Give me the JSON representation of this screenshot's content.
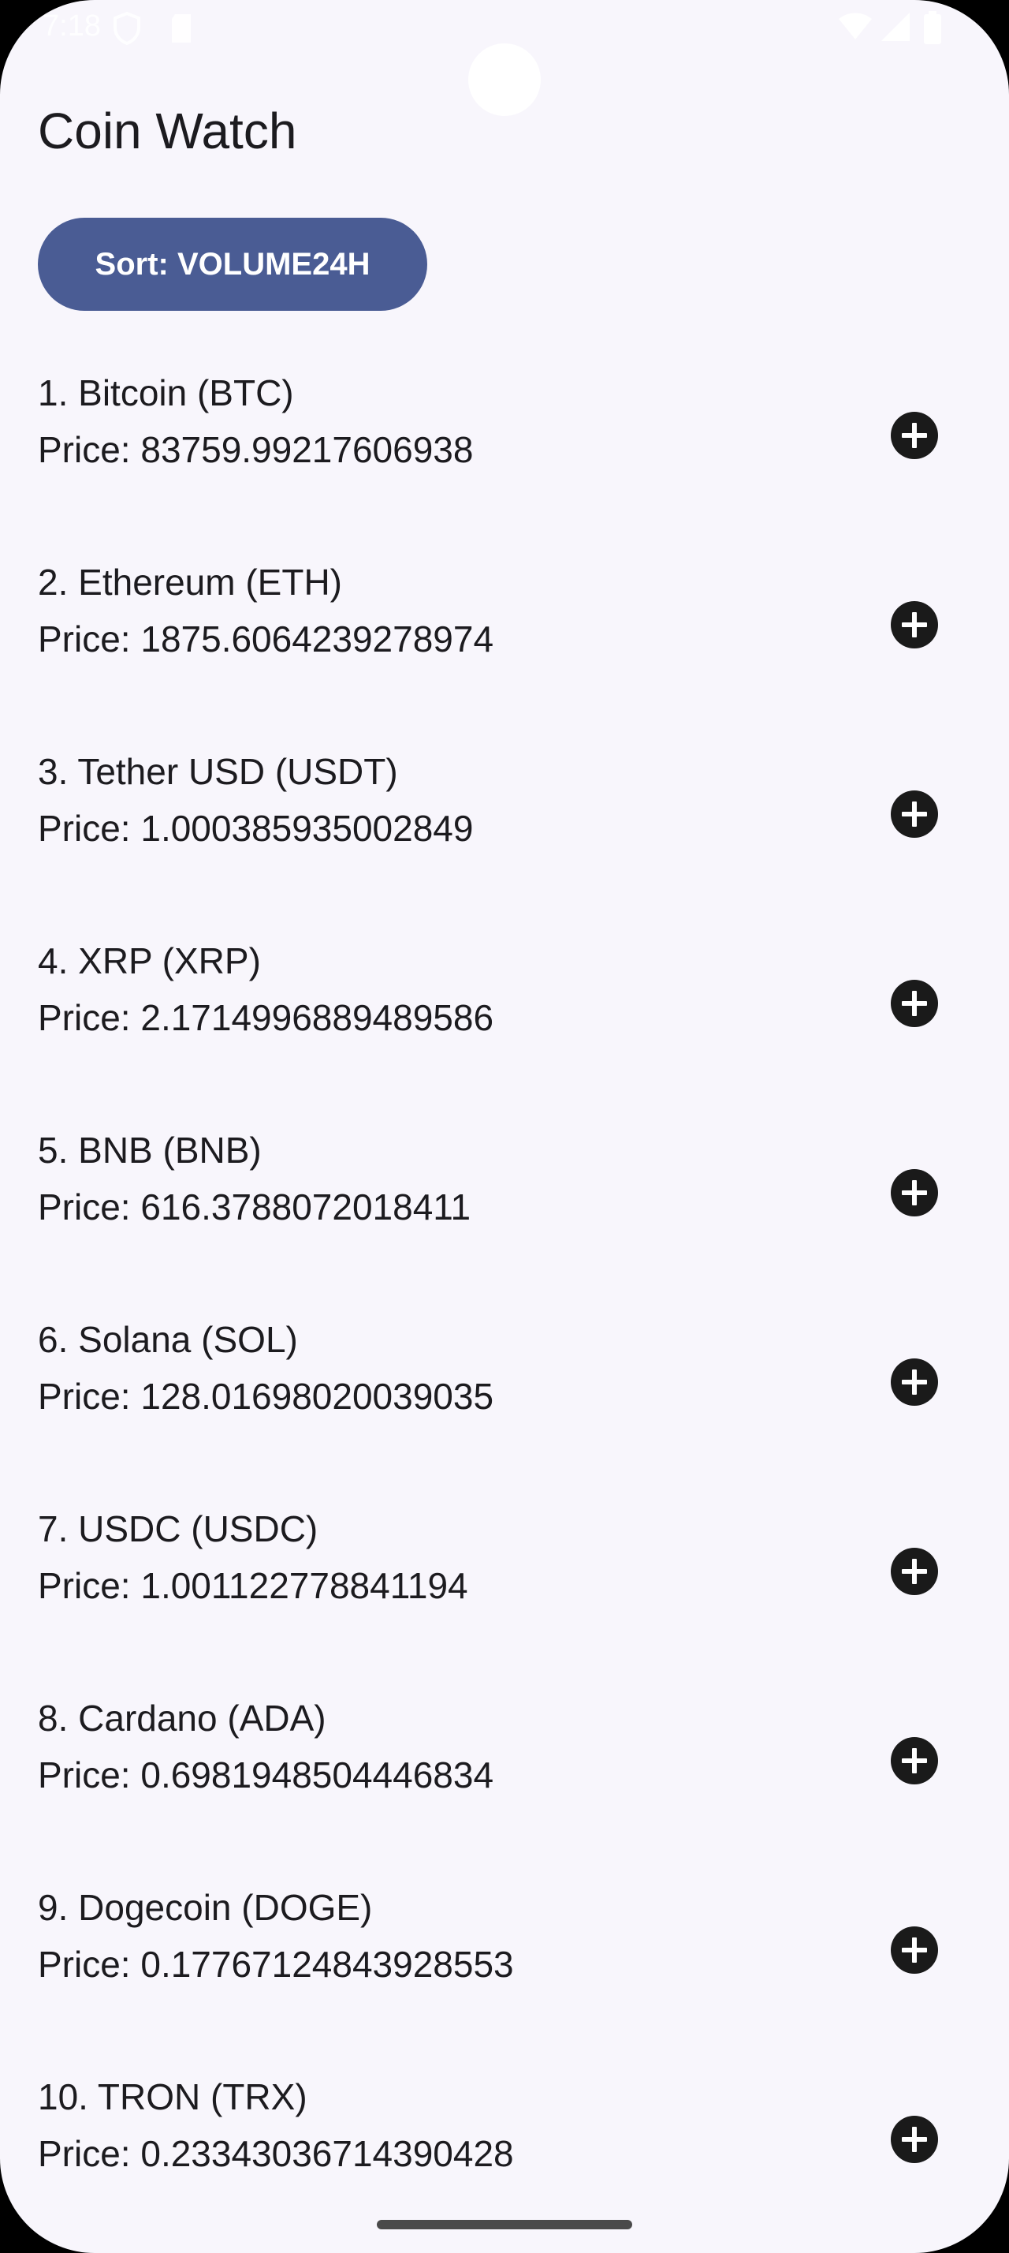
{
  "status_bar": {
    "time": "7:18",
    "icons": [
      "shield-icon",
      "sim-card-icon",
      "wifi-icon",
      "cellular-icon",
      "battery-icon"
    ]
  },
  "header": {
    "title": "Coin Watch"
  },
  "sort": {
    "label": "Sort: VOLUME24H"
  },
  "coins": [
    {
      "name": "1. Bitcoin (BTC)",
      "price": "Price: 83759.99217606938"
    },
    {
      "name": "2. Ethereum (ETH)",
      "price": "Price: 1875.6064239278974"
    },
    {
      "name": "3. Tether USD (USDT)",
      "price": "Price: 1.000385935002849"
    },
    {
      "name": "4. XRP (XRP)",
      "price": "Price: 2.1714996889489586"
    },
    {
      "name": "5. BNB (BNB)",
      "price": "Price: 616.3788072018411"
    },
    {
      "name": "6. Solana (SOL)",
      "price": "Price: 128.01698020039035"
    },
    {
      "name": "7. USDC (USDC)",
      "price": "Price: 1.001122778841194"
    },
    {
      "name": "8. Cardano (ADA)",
      "price": "Price: 0.6981948504446834"
    },
    {
      "name": "9. Dogecoin (DOGE)",
      "price": "Price: 0.17767124843928553"
    },
    {
      "name": "10. TRON (TRX)",
      "price": "Price: 0.23343036714390428"
    }
  ],
  "add_icon": "add-circle-icon",
  "colors": {
    "background": "#f8f6fc",
    "accent": "#4a5c94",
    "text": "#1c1b1f",
    "icon": "#1a1a1a"
  }
}
